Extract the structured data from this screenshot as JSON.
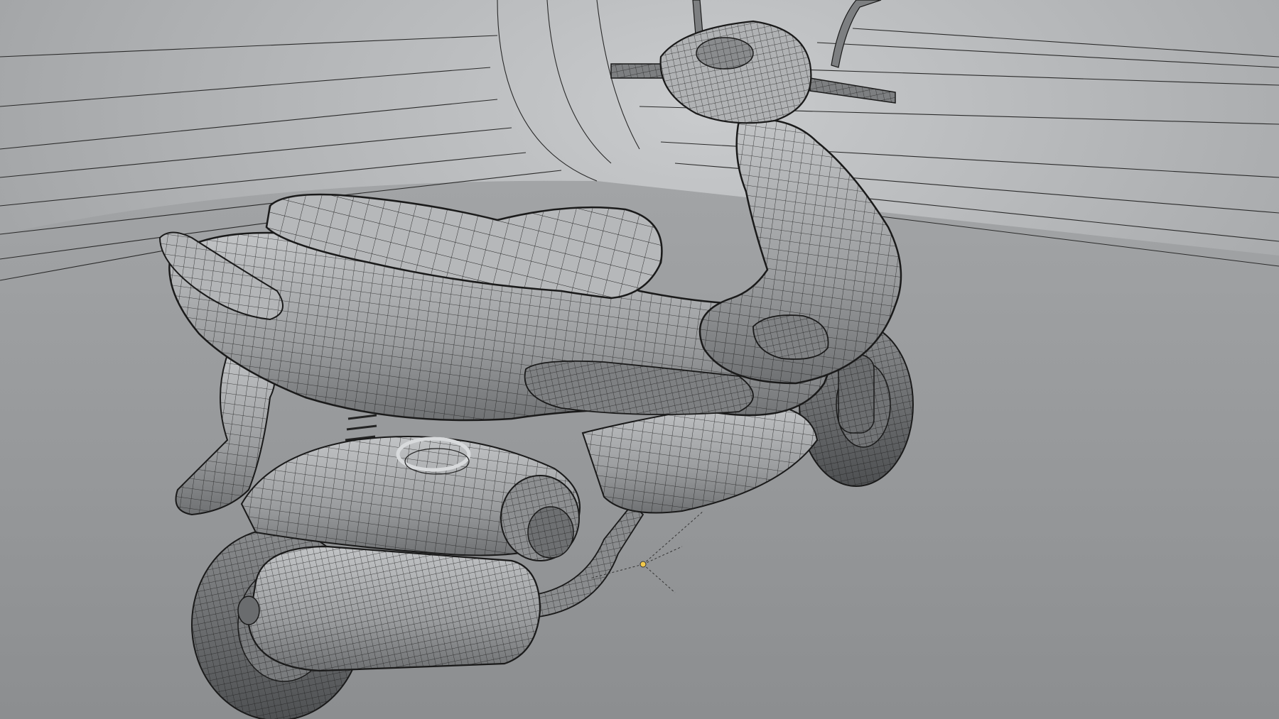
{
  "viewport": {
    "kind": "3d-modeling-viewport",
    "shading": "wireframe-on-shaded",
    "model": "scooter-mesh",
    "background_color": "#8d8f91",
    "backdrop_color": "#b9bbbd",
    "floor_color": "#96989a",
    "mesh_color": "#a4a6a8",
    "wire_color": "#222222",
    "gizmo_color": "#f2c94c"
  },
  "icons": {
    "origin_pivot": "crosshair-pivot-icon"
  }
}
